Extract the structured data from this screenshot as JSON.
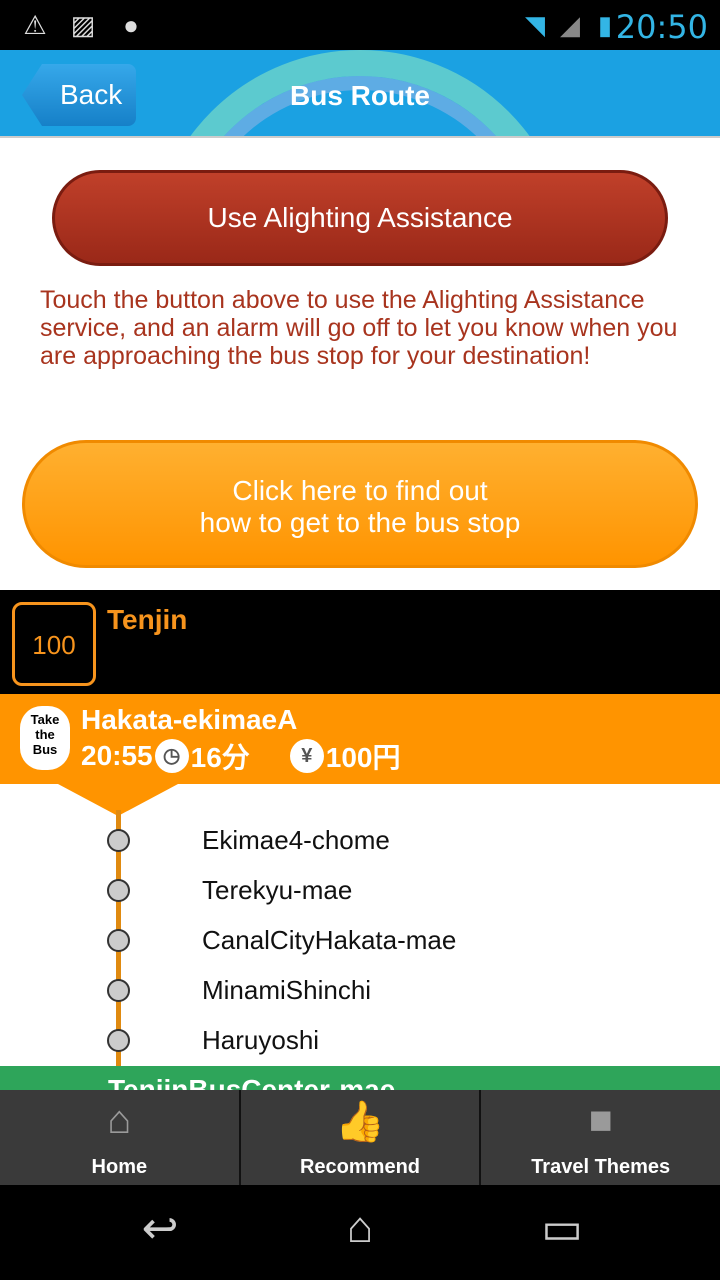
{
  "status_bar": {
    "time": "20:50",
    "icons": [
      "warning-icon",
      "image-icon",
      "android-icon",
      "wifi-icon",
      "signal-icon",
      "battery-charging-icon"
    ]
  },
  "header": {
    "back_label": "Back",
    "title": "Bus Route"
  },
  "alighting_button": "Use Alighting Assistance",
  "description": "Touch the button above to use the Alighting Assistance service, and an alarm will go off to let you know when you are approaching the bus stop for your destination!",
  "find_stop_button": {
    "line1": "Click here to find out",
    "line2": "how to get to the bus stop"
  },
  "route": {
    "number": "100",
    "destination": "Tenjin"
  },
  "boarding": {
    "logo": "Take the Bus",
    "stop": "Hakata-ekimaeA",
    "time": "20:55",
    "duration": "16分",
    "fare": "100円"
  },
  "stops": [
    "Ekimae4-chome",
    "Terekyu-mae",
    "CanalCityHakata-mae",
    "MinamiShinchi",
    "Haruyoshi"
  ],
  "alighting_stop": "TenjinBusCenter-mae",
  "tabs": [
    {
      "label": "Home",
      "icon": "home-icon"
    },
    {
      "label": "Recommend",
      "icon": "thumbs-up-icon"
    },
    {
      "label": "Travel Themes",
      "icon": "suitcase-icon"
    }
  ],
  "colors": {
    "header": "#1ba1e2",
    "alight_button": "#a8341e",
    "orange": "#ff9400",
    "green": "#2ea55a"
  }
}
